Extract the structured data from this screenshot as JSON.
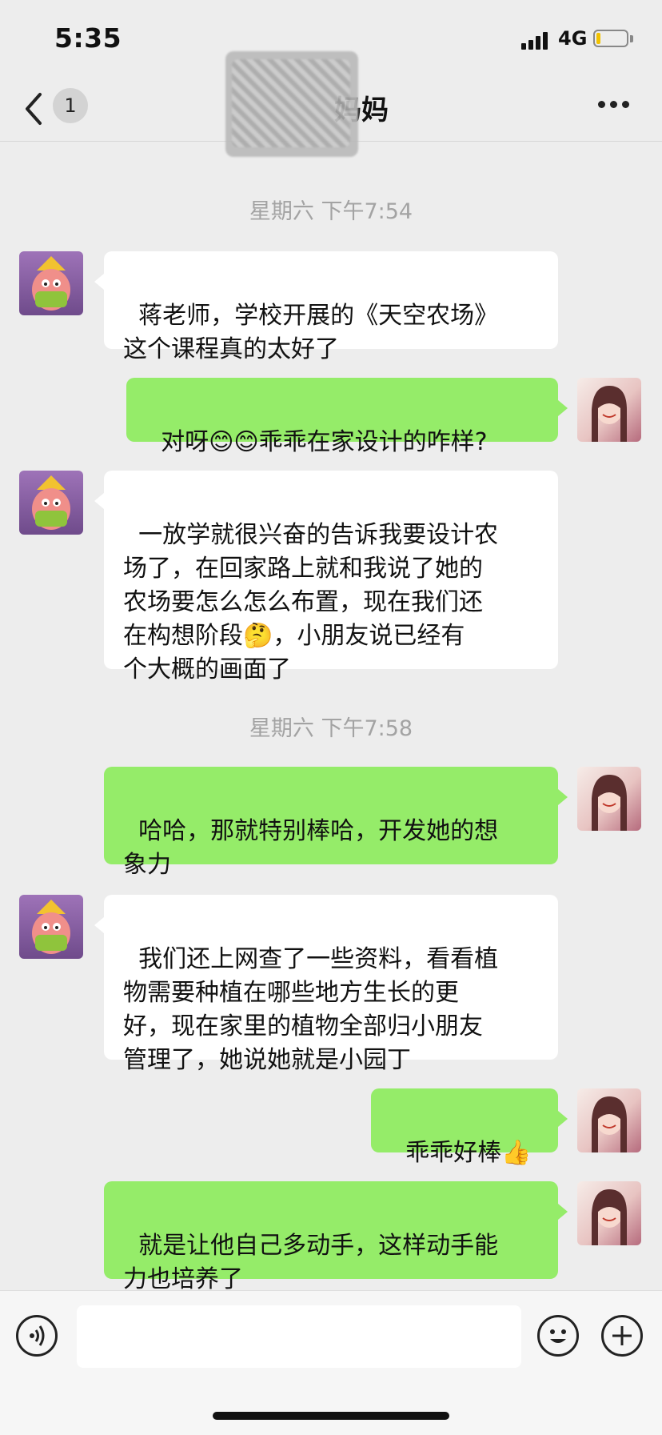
{
  "status_bar": {
    "time": "5:35",
    "network": "4G"
  },
  "nav": {
    "back_badge": "1",
    "title": "妈妈"
  },
  "chat": {
    "timestamps": [
      "星期六 下午7:54",
      "星期六 下午7:58"
    ],
    "messages": [
      {
        "sender": "parent",
        "text": "蒋老师，学校开展的《天空农场》\n这个课程真的太好了"
      },
      {
        "sender": "teacher",
        "text_before": "对呀",
        "emoji": "😊😊",
        "text_after": "乖乖在家设计的咋样?"
      },
      {
        "sender": "parent",
        "text_before": "一放学就很兴奋的告诉我要设计农\n场了，在回家路上就和我说了她的\n农场要怎么怎么布置，现在我们还\n在构想阶段",
        "emoji": "🤔",
        "text_after": "，小朋友说已经有\n个大概的画面了"
      },
      {
        "sender": "teacher",
        "text": "哈哈，那就特别棒哈，开发她的想\n象力"
      },
      {
        "sender": "parent",
        "text": "我们还上网查了一些资料，看看植\n物需要种植在哪些地方生长的更\n好，现在家里的植物全部归小朋友\n管理了，她说她就是小园丁"
      },
      {
        "sender": "teacher",
        "text_before": "乖乖好棒",
        "emoji": "👍",
        "text_after": ""
      },
      {
        "sender": "teacher",
        "text": "就是让他自己多动手，这样动手能\n力也培养了"
      }
    ]
  },
  "input_bar": {
    "placeholder": ""
  },
  "icons": {
    "back": "chevron-left-icon",
    "more": "more-dots-icon",
    "voice": "voice-icon",
    "emoji": "smiley-icon",
    "plus": "plus-icon"
  },
  "colors": {
    "outgoing_bubble": "#95ec69",
    "incoming_bubble": "#ffffff",
    "background": "#ededed"
  }
}
